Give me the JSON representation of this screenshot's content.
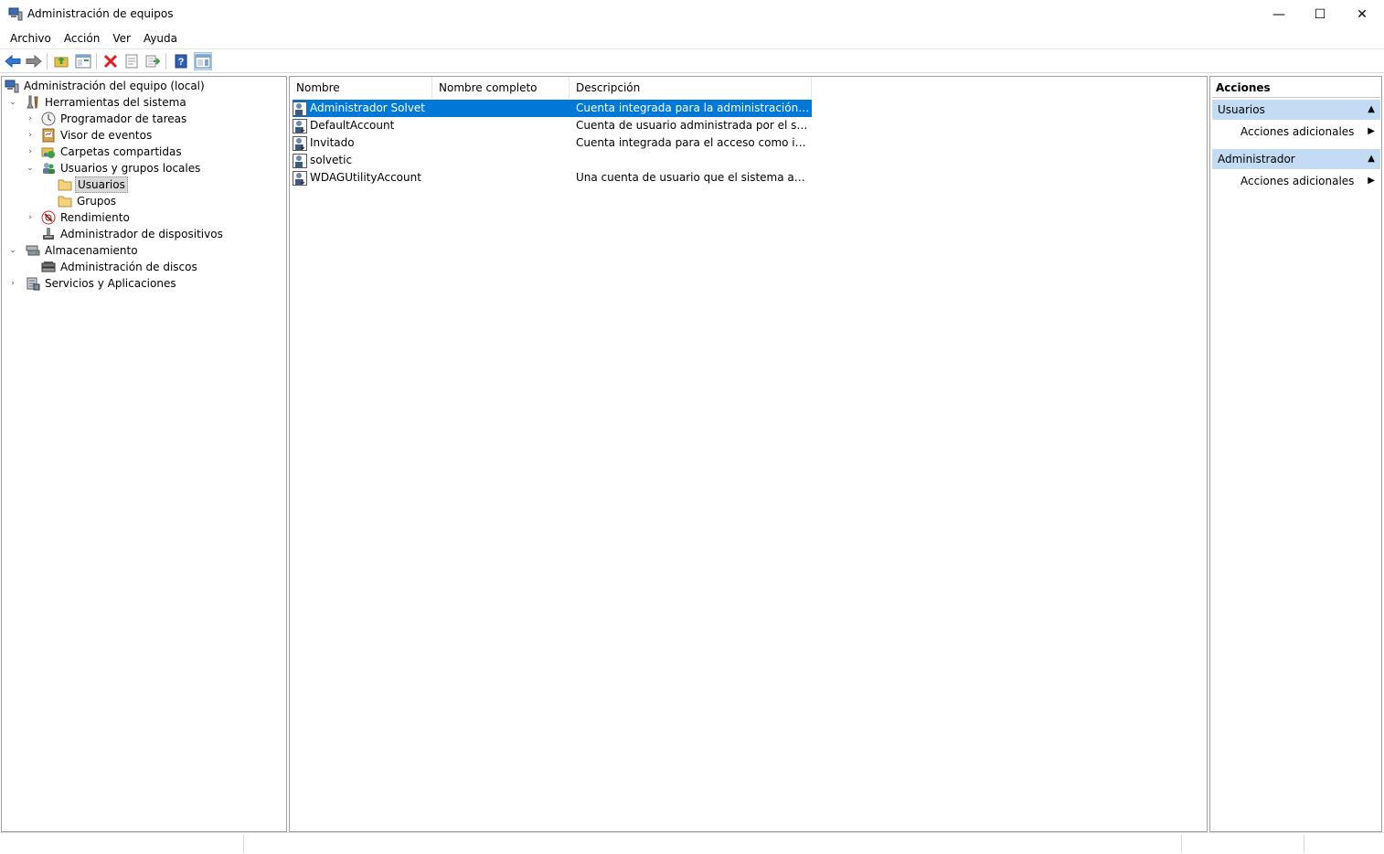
{
  "window": {
    "title": "Administración de equipos",
    "min_glyph": "—",
    "max_glyph": "☐",
    "close_glyph": "✕"
  },
  "menu": [
    "Archivo",
    "Acción",
    "Ver",
    "Ayuda"
  ],
  "toolbar": {
    "icons": [
      "back-arrow-icon",
      "forward-arrow-icon",
      "up-folder-icon",
      "show-hide-tree-icon",
      "delete-icon",
      "properties-icon",
      "export-list-icon",
      "help-icon",
      "show-hide-action-pane-icon"
    ]
  },
  "tree": {
    "items": [
      {
        "label": "Administración del equipo (local)",
        "icon": "computer-management-icon",
        "expander": ""
      },
      {
        "label": "Herramientas del sistema",
        "icon": "system-tools-icon",
        "expander": "⌄"
      },
      {
        "label": "Programador de tareas",
        "icon": "clock-icon",
        "expander": "›"
      },
      {
        "label": "Visor de eventos",
        "icon": "event-viewer-icon",
        "expander": "›"
      },
      {
        "label": "Carpetas compartidas",
        "icon": "shared-folders-icon",
        "expander": "›"
      },
      {
        "label": "Usuarios y grupos locales",
        "icon": "users-groups-icon",
        "expander": "⌄"
      },
      {
        "label": "Usuarios",
        "icon": "folder-icon",
        "expander": ""
      },
      {
        "label": "Grupos",
        "icon": "folder-icon",
        "expander": ""
      },
      {
        "label": "Rendimiento",
        "icon": "performance-icon",
        "expander": "›"
      },
      {
        "label": "Administrador de dispositivos",
        "icon": "device-manager-icon",
        "expander": ""
      },
      {
        "label": "Almacenamiento",
        "icon": "storage-icon",
        "expander": "⌄"
      },
      {
        "label": "Administración de discos",
        "icon": "disk-management-icon",
        "expander": ""
      },
      {
        "label": "Servicios y Aplicaciones",
        "icon": "services-apps-icon",
        "expander": "›"
      }
    ]
  },
  "list": {
    "columns": [
      "Nombre",
      "Nombre completo",
      "Descripción"
    ],
    "rows": [
      {
        "name": "Administrador Solvet",
        "full_name": "",
        "description": "Cuenta integrada para la administración del e..."
      },
      {
        "name": "DefaultAccount",
        "full_name": "",
        "description": "Cuenta de usuario administrada por el sistema."
      },
      {
        "name": "Invitado",
        "full_name": "",
        "description": "Cuenta integrada para el acceso como invitad..."
      },
      {
        "name": "solvetic",
        "full_name": "",
        "description": ""
      },
      {
        "name": "WDAGUtilityAccount",
        "full_name": "",
        "description": "Una cuenta de usuario que el sistema adminis..."
      }
    ]
  },
  "actions": {
    "header": "Acciones",
    "groups": [
      {
        "title": "Usuarios",
        "item": "Acciones adicionales"
      },
      {
        "title": "Administrador",
        "item": "Acciones adicionales"
      }
    ],
    "caret_glyph": "▲",
    "arrow_glyph": "▶"
  },
  "colors": {
    "selection": "#0078d7",
    "action_group_bg": "#c4dcf3",
    "tree_selected_bg": "#d9d9d9"
  }
}
